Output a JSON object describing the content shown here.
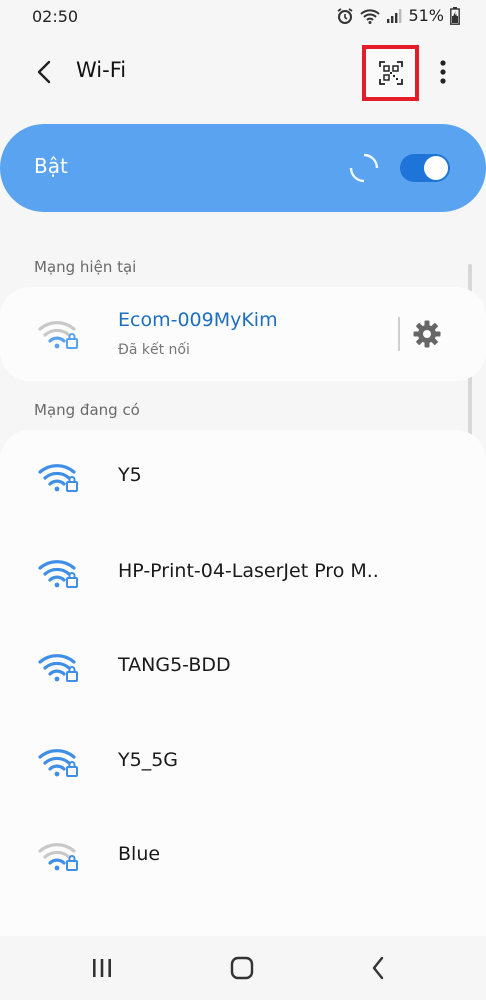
{
  "status_bar": {
    "time": "02:50",
    "battery": "51%"
  },
  "header": {
    "title": "Wi-Fi"
  },
  "master": {
    "label": "Bật",
    "enabled": true
  },
  "sections": {
    "current": "Mạng hiện tại",
    "available": "Mạng đang có"
  },
  "current_network": {
    "name": "Ecom-009MyKim",
    "status": "Đã kết nối",
    "signal_bars": 1
  },
  "networks": [
    {
      "name": "Y5",
      "signal_bars": 3
    },
    {
      "name": "HP-Print-04-LaserJet Pro M..",
      "signal_bars": 3
    },
    {
      "name": "TANG5-BDD",
      "signal_bars": 3
    },
    {
      "name": "Y5_5G",
      "signal_bars": 3
    },
    {
      "name": "Blue",
      "signal_bars": 1
    }
  ],
  "colors": {
    "accent": "#1e74d8",
    "toggle_bg": "#5aa3f0",
    "highlight": "#e51d2a",
    "connected_text": "#1f6fbe"
  },
  "icons": {
    "back": "back-arrow-icon",
    "qr": "qr-code-icon",
    "more": "more-vert-icon",
    "gear": "gear-icon",
    "wifi": "wifi-lock-icon"
  }
}
